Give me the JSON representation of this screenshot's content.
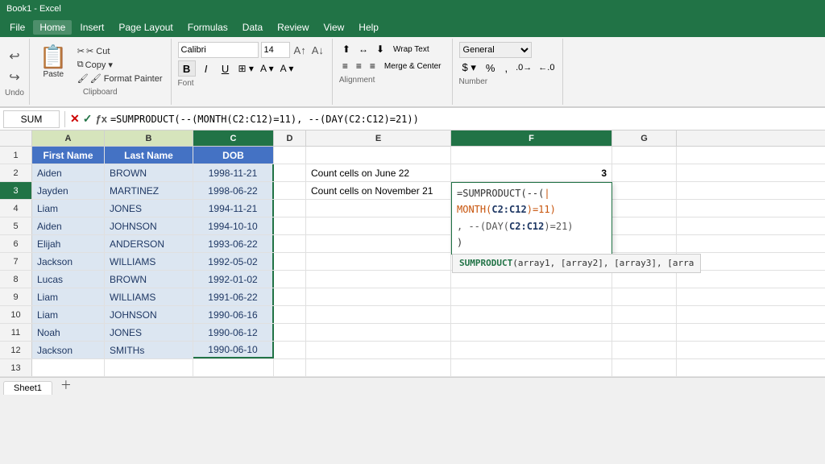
{
  "titlebar": {
    "text": "Book1 - Excel"
  },
  "menubar": {
    "items": [
      "File",
      "Home",
      "Insert",
      "Page Layout",
      "Formulas",
      "Data",
      "Review",
      "View",
      "Help"
    ]
  },
  "ribbon": {
    "undo_label": "Undo",
    "redo_label": "Redo",
    "clipboard_label": "Clipboard",
    "paste_label": "Paste",
    "cut_label": "✂ Cut",
    "copy_label": "📋 Copy",
    "format_painter_label": "🖌 Format Painter",
    "font_label": "Font",
    "font_name": "Calibri",
    "font_size": "14",
    "bold_label": "B",
    "italic_label": "I",
    "underline_label": "U",
    "alignment_label": "Alignment",
    "wrap_text_label": "Wrap Text",
    "merge_center_label": "Merge & Center",
    "number_label": "Number",
    "number_format": "General"
  },
  "formula_bar": {
    "name_box": "SUM",
    "formula": "=SUMPRODUCT(--(MONTH(C2:C12)=11), --(DAY(C2:C12)=21))"
  },
  "columns": {
    "headers": [
      "A",
      "B",
      "C",
      "D",
      "E",
      "F",
      "G"
    ]
  },
  "rows": [
    {
      "num": "1",
      "cells": [
        {
          "col": "A",
          "value": "First Name",
          "type": "header"
        },
        {
          "col": "B",
          "value": "Last Name",
          "type": "header"
        },
        {
          "col": "C",
          "value": "DOB",
          "type": "header"
        },
        {
          "col": "D",
          "value": "",
          "type": "normal"
        },
        {
          "col": "E",
          "value": "",
          "type": "normal"
        },
        {
          "col": "F",
          "value": "",
          "type": "normal"
        },
        {
          "col": "G",
          "value": "",
          "type": "normal"
        }
      ]
    },
    {
      "num": "2",
      "cells": [
        {
          "col": "A",
          "value": "Aiden",
          "type": "data"
        },
        {
          "col": "B",
          "value": "BROWN",
          "type": "data"
        },
        {
          "col": "C",
          "value": "1998-11-21",
          "type": "data-center"
        },
        {
          "col": "D",
          "value": "",
          "type": "normal"
        },
        {
          "col": "E",
          "value": "Count cells on June 22",
          "type": "normal"
        },
        {
          "col": "F",
          "value": "3",
          "type": "result"
        },
        {
          "col": "G",
          "value": "",
          "type": "normal"
        }
      ]
    },
    {
      "num": "3",
      "cells": [
        {
          "col": "A",
          "value": "Jayden",
          "type": "data"
        },
        {
          "col": "B",
          "value": "MARTINEZ",
          "type": "data"
        },
        {
          "col": "C",
          "value": "1998-06-22",
          "type": "data-center"
        },
        {
          "col": "D",
          "value": "",
          "type": "normal"
        },
        {
          "col": "E",
          "value": "Count cells on November 21",
          "type": "normal"
        },
        {
          "col": "F",
          "value": "=SUMPRODUCT(--(",
          "type": "formula-active"
        },
        {
          "col": "G",
          "value": "",
          "type": "normal"
        }
      ]
    },
    {
      "num": "4",
      "cells": [
        {
          "col": "A",
          "value": "Liam",
          "type": "data"
        },
        {
          "col": "B",
          "value": "JONES",
          "type": "data"
        },
        {
          "col": "C",
          "value": "1994-11-21",
          "type": "data-center"
        },
        {
          "col": "D",
          "value": "",
          "type": "normal"
        },
        {
          "col": "E",
          "value": "",
          "type": "normal"
        },
        {
          "col": "F",
          "value": "",
          "type": "normal"
        },
        {
          "col": "G",
          "value": "",
          "type": "normal"
        }
      ]
    },
    {
      "num": "5",
      "cells": [
        {
          "col": "A",
          "value": "Aiden",
          "type": "data"
        },
        {
          "col": "B",
          "value": "JOHNSON",
          "type": "data"
        },
        {
          "col": "C",
          "value": "1994-10-10",
          "type": "data-center"
        },
        {
          "col": "D",
          "value": "",
          "type": "normal"
        },
        {
          "col": "E",
          "value": "",
          "type": "normal"
        },
        {
          "col": "F",
          "value": "",
          "type": "normal"
        },
        {
          "col": "G",
          "value": "",
          "type": "normal"
        }
      ]
    },
    {
      "num": "6",
      "cells": [
        {
          "col": "A",
          "value": "Elijah",
          "type": "data"
        },
        {
          "col": "B",
          "value": "ANDERSON",
          "type": "data"
        },
        {
          "col": "C",
          "value": "1993-06-22",
          "type": "data-center"
        },
        {
          "col": "D",
          "value": "",
          "type": "normal"
        },
        {
          "col": "E",
          "value": "",
          "type": "normal"
        },
        {
          "col": "F",
          "value": "",
          "type": "normal"
        },
        {
          "col": "G",
          "value": "",
          "type": "normal"
        }
      ]
    },
    {
      "num": "7",
      "cells": [
        {
          "col": "A",
          "value": "Jackson",
          "type": "data"
        },
        {
          "col": "B",
          "value": "WILLIAMS",
          "type": "data"
        },
        {
          "col": "C",
          "value": "1992-05-02",
          "type": "data-center"
        },
        {
          "col": "D",
          "value": "",
          "type": "normal"
        },
        {
          "col": "E",
          "value": "",
          "type": "normal"
        },
        {
          "col": "F",
          "value": "",
          "type": "normal"
        },
        {
          "col": "G",
          "value": "",
          "type": "normal"
        }
      ]
    },
    {
      "num": "8",
      "cells": [
        {
          "col": "A",
          "value": "Lucas",
          "type": "data"
        },
        {
          "col": "B",
          "value": "BROWN",
          "type": "data"
        },
        {
          "col": "C",
          "value": "1992-01-02",
          "type": "data-center"
        },
        {
          "col": "D",
          "value": "",
          "type": "normal"
        },
        {
          "col": "E",
          "value": "",
          "type": "normal"
        },
        {
          "col": "F",
          "value": "",
          "type": "normal"
        },
        {
          "col": "G",
          "value": "",
          "type": "normal"
        }
      ]
    },
    {
      "num": "9",
      "cells": [
        {
          "col": "A",
          "value": "Liam",
          "type": "data"
        },
        {
          "col": "B",
          "value": "WILLIAMS",
          "type": "data"
        },
        {
          "col": "C",
          "value": "1991-06-22",
          "type": "data-center"
        },
        {
          "col": "D",
          "value": "",
          "type": "normal"
        },
        {
          "col": "E",
          "value": "",
          "type": "normal"
        },
        {
          "col": "F",
          "value": "",
          "type": "normal"
        },
        {
          "col": "G",
          "value": "",
          "type": "normal"
        }
      ]
    },
    {
      "num": "10",
      "cells": [
        {
          "col": "A",
          "value": "Liam",
          "type": "data"
        },
        {
          "col": "B",
          "value": "JOHNSON",
          "type": "data"
        },
        {
          "col": "C",
          "value": "1990-06-16",
          "type": "data-center"
        },
        {
          "col": "D",
          "value": "",
          "type": "normal"
        },
        {
          "col": "E",
          "value": "",
          "type": "normal"
        },
        {
          "col": "F",
          "value": "",
          "type": "normal"
        },
        {
          "col": "G",
          "value": "",
          "type": "normal"
        }
      ]
    },
    {
      "num": "11",
      "cells": [
        {
          "col": "A",
          "value": "Noah",
          "type": "data"
        },
        {
          "col": "B",
          "value": "JONES",
          "type": "data"
        },
        {
          "col": "C",
          "value": "1990-06-12",
          "type": "data-center"
        },
        {
          "col": "D",
          "value": "",
          "type": "normal"
        },
        {
          "col": "E",
          "value": "",
          "type": "normal"
        },
        {
          "col": "F",
          "value": "",
          "type": "normal"
        },
        {
          "col": "G",
          "value": "",
          "type": "normal"
        }
      ]
    },
    {
      "num": "12",
      "cells": [
        {
          "col": "A",
          "value": "Jackson",
          "type": "data"
        },
        {
          "col": "B",
          "value": "SMITHs",
          "type": "data"
        },
        {
          "col": "C",
          "value": "1990-06-10",
          "type": "data-center"
        },
        {
          "col": "D",
          "value": "",
          "type": "normal"
        },
        {
          "col": "E",
          "value": "",
          "type": "normal"
        },
        {
          "col": "F",
          "value": "",
          "type": "normal"
        },
        {
          "col": "G",
          "value": "",
          "type": "normal"
        }
      ]
    },
    {
      "num": "13",
      "cells": [
        {
          "col": "A",
          "value": "",
          "type": "normal"
        },
        {
          "col": "B",
          "value": "",
          "type": "normal"
        },
        {
          "col": "C",
          "value": "",
          "type": "normal"
        },
        {
          "col": "D",
          "value": "",
          "type": "normal"
        },
        {
          "col": "E",
          "value": "",
          "type": "normal"
        },
        {
          "col": "F",
          "value": "",
          "type": "normal"
        },
        {
          "col": "G",
          "value": "",
          "type": "normal"
        }
      ]
    }
  ],
  "sheet_tabs": [
    "Sheet1"
  ],
  "formula_popup": {
    "line1": "=SUMPRODUCT(--(",
    "line2_pre": "MONTH(",
    "line2_ref": "C2:C12",
    "line2_post": ")=11)",
    "line3_pre": ", --(DAY(",
    "line3_ref": "C2:C12",
    "line3_post": ")=21)",
    "line4": ")"
  },
  "func_tooltip": "SUMPRODUCT(array1, [array2], [array3], [arra"
}
